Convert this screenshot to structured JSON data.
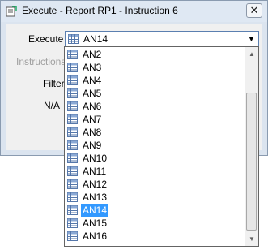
{
  "window": {
    "title": "Execute - Report RP1 - Instruction 6",
    "close_glyph": "✕"
  },
  "form": {
    "execute_label": "Execute",
    "instructions_label": "Instructions",
    "filter_label": "Filter",
    "na_label": "N/A",
    "execute_value": "AN14",
    "dropdown_arrow": "▼"
  },
  "dropdown": {
    "items": [
      "AN2",
      "AN3",
      "AN4",
      "AN5",
      "AN6",
      "AN7",
      "AN8",
      "AN9",
      "AN10",
      "AN11",
      "AN12",
      "AN13",
      "AN14",
      "AN15",
      "AN16"
    ],
    "selected": "AN14",
    "item_icon": "table-icon"
  },
  "scrollbar": {
    "up_glyph": "▲",
    "down_glyph": "▼"
  },
  "colors": {
    "selection": "#3399ff",
    "window_frame": "#dbe4ef"
  }
}
